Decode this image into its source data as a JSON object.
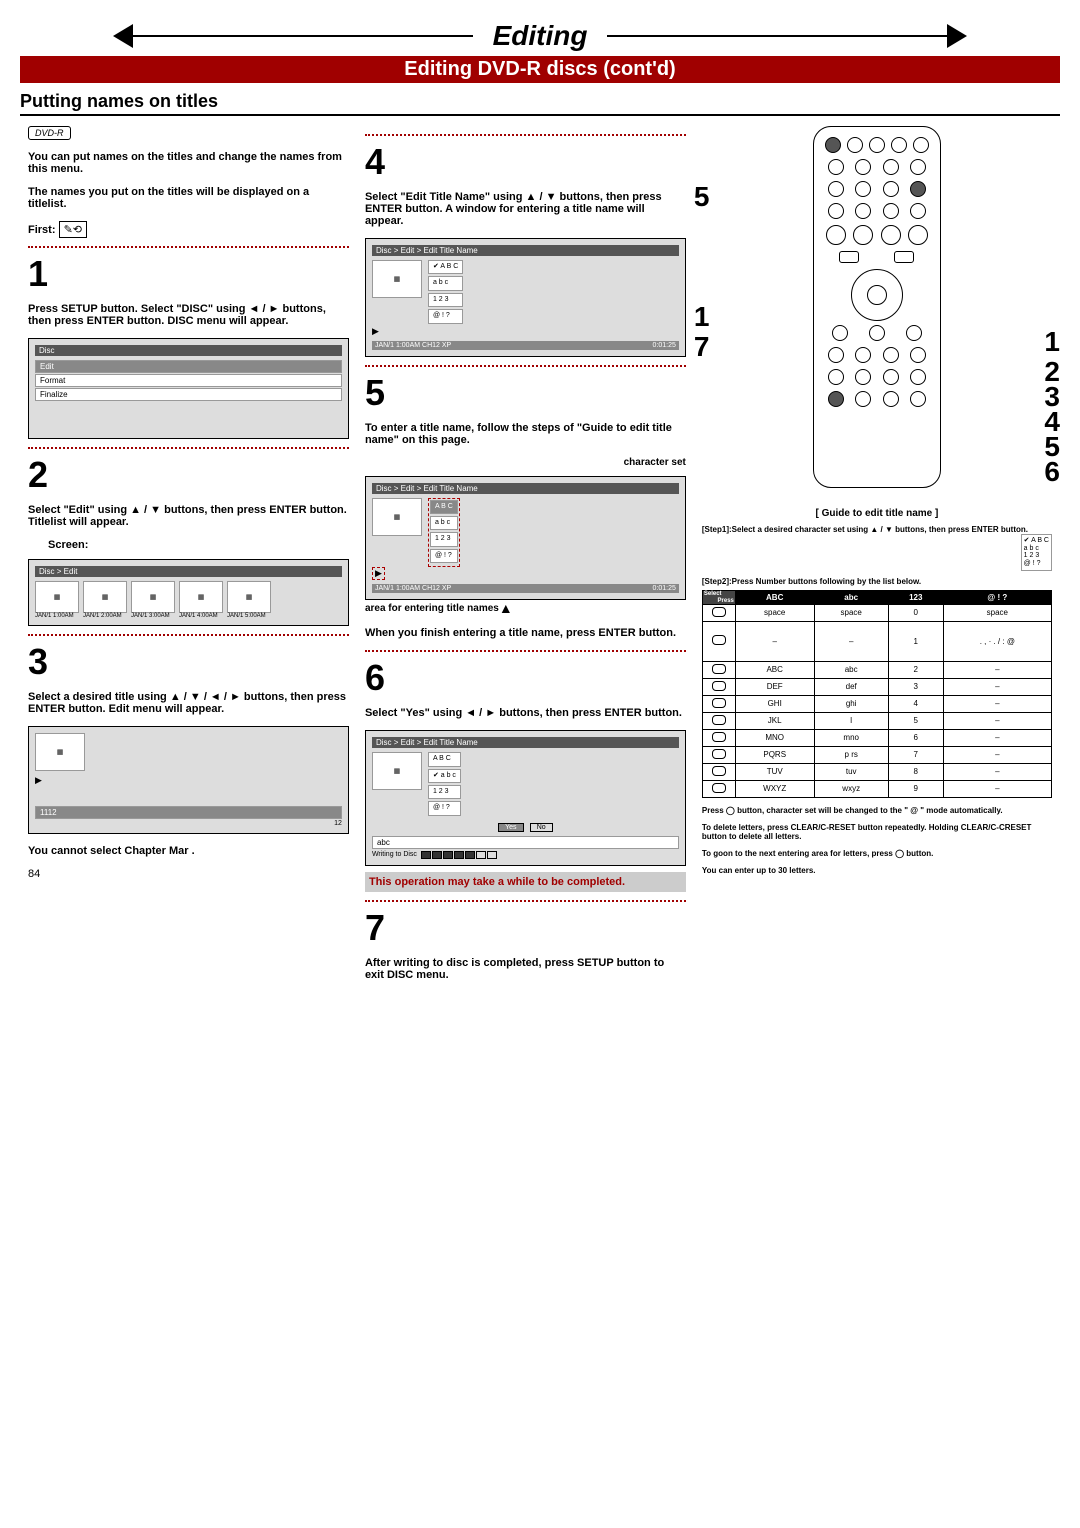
{
  "header": {
    "title": "Editing",
    "subtitle": "Editing DVD-R discs (cont'd)",
    "section": "Putting names on titles"
  },
  "badge": "DVD-R",
  "intro": {
    "l1": "You can put names on the titles and change the names from this menu.",
    "l2": "The names you put on the titles will be displayed on a titlelist.",
    "first": "First:"
  },
  "steps": {
    "s1": "Press SETUP button. Select \"DISC\" using ◄ / ► buttons, then press ENTER button. DISC menu will appear.",
    "s2a": "Select \"Edit\" using ▲ / ▼ buttons, then press ENTER button. Titlelist will appear.",
    "s2b": "Screen:",
    "s3a": "Select a desired title using ▲ / ▼ / ◄ / ► buttons, then press ENTER button. Edit menu will appear.",
    "s3note": "You cannot select Chapter Mar .",
    "s4": "Select \"Edit Title Name\" using ▲ / ▼ buttons, then press ENTER button. A window for entering a title name will appear.",
    "s5a": "To enter a title name, follow the steps of \"Guide to edit title name\" on this page.",
    "s5charset": "character set",
    "s5area": "area for entering title names",
    "s5b": "When you finish entering a title name, press ENTER button.",
    "s6": "Select \"Yes\" using ◄ / ► buttons, then press ENTER button.",
    "s6box": "This operation may take a while to be completed.",
    "s7": "After writing to disc is completed, press SETUP button to exit DISC menu."
  },
  "screens": {
    "disc_menu": {
      "header": "Disc",
      "items": [
        "Edit",
        "Format",
        "Finalize"
      ]
    },
    "titlelist": {
      "header": "Disc > Edit",
      "thumbs": [
        "JAN/1 1:00AM",
        "JAN/1 2:00AM",
        "JAN/1 3:00AM",
        "JAN/1 4:00AM",
        "JAN/1 5:00AM"
      ]
    },
    "editmenu": {
      "items": [
        "1112"
      ],
      "right": "12"
    },
    "editname": {
      "header": "Disc > Edit > Edit Title Name",
      "charset": [
        "✔ A B C",
        "a b c",
        "1 2 3",
        "@ ! ?"
      ],
      "status_l": "JAN/1 1:00AM CH12 XP",
      "status_r": "0:01:25"
    },
    "editname2_charset": [
      "A B C",
      "a b c",
      "1 2 3",
      "@ ! ?"
    ],
    "yesno": {
      "text": "abc",
      "writing": "Writing to Disc",
      "yes": "Yes",
      "no": "No",
      "charset": [
        "A B C",
        "✔ a b c",
        "1 2 3",
        "@ ! ?"
      ]
    }
  },
  "guide": {
    "title": "[ Guide to edit title name ]",
    "step1": "[Step1]:Select a desired character set using ▲ / ▼ buttons, then press ENTER button.",
    "step1_charset": [
      "✔ A B C",
      "a b c",
      "1 2 3",
      "@ ! ?"
    ],
    "step2": "[Step2]:Press Number buttons following by the list below.",
    "table_head": [
      "ABC",
      "abc",
      "123",
      "@ ! ?"
    ],
    "rows": [
      [
        "space",
        "space",
        "0",
        "space"
      ],
      [
        "–",
        "–",
        "1",
        ". , · . / : @"
      ],
      [
        "ABC",
        "abc",
        "2",
        "–"
      ],
      [
        "DEF",
        "def",
        "3",
        "–"
      ],
      [
        "GHI",
        "ghi",
        "4",
        "–"
      ],
      [
        "JKL",
        "l",
        "5",
        "–"
      ],
      [
        "MNO",
        "mno",
        "6",
        "–"
      ],
      [
        "PQRS",
        "p rs",
        "7",
        "–"
      ],
      [
        "TUV",
        "tuv",
        "8",
        "–"
      ],
      [
        "WXYZ",
        "wxyz",
        "9",
        "–"
      ]
    ],
    "note1": "Press ◯ button, character set will be changed to the \" @ \" mode automatically.",
    "note2": "To delete letters, press CLEAR/C-RESET button repeatedly. Holding CLEAR/C-CRESET button to delete all letters.",
    "note3": "To goon to the next entering area for letters, press ◯ button.",
    "note4": "You can enter up to 30 letters."
  },
  "select_label": "Select",
  "press_label": "Press",
  "pagenum": "84"
}
